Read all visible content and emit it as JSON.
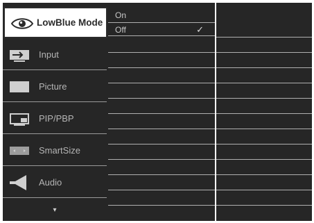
{
  "menu": {
    "items": [
      {
        "label": "LowBlue Mode",
        "icon": "eye-icon",
        "selected": true
      },
      {
        "label": "Input",
        "icon": "input-icon"
      },
      {
        "label": "Picture",
        "icon": "picture-icon"
      },
      {
        "label": "PIP/PBP",
        "icon": "pip-pbp-icon"
      },
      {
        "label": "SmartSize",
        "icon": "smartsize-icon"
      },
      {
        "label": "Audio",
        "icon": "speaker-icon"
      }
    ],
    "more_indicator": "▾"
  },
  "submenu": {
    "options": [
      {
        "label": "On",
        "checked": false
      },
      {
        "label": "Off",
        "checked": true,
        "check_mark": "✓"
      }
    ]
  },
  "colors": {
    "panel": "#262626",
    "selected_bg": "#ffffff",
    "text": "#c9c9c9",
    "separator": "#b0b0b0"
  }
}
